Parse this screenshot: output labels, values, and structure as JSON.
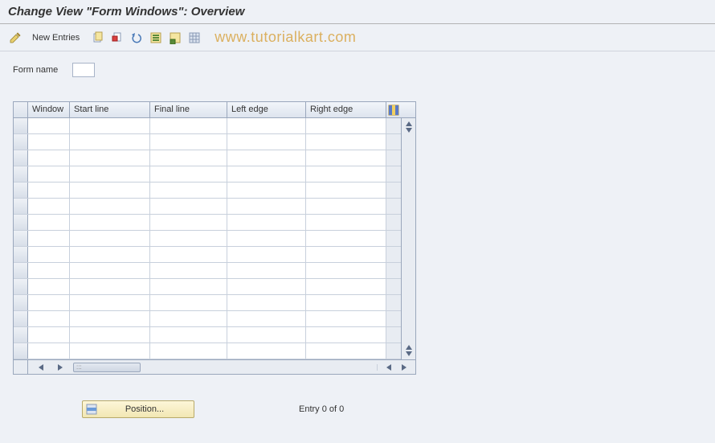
{
  "titlebar": {
    "title": "Change View \"Form Windows\": Overview"
  },
  "toolbar": {
    "new_entries_label": "New Entries",
    "watermark": "www.tutorialkart.com"
  },
  "form": {
    "form_name_label": "Form name",
    "form_name_value": ""
  },
  "table": {
    "columns": {
      "window": "Window",
      "start_line": "Start line",
      "final_line": "Final line",
      "left_edge": "Left edge",
      "right_edge": "Right edge"
    },
    "row_count": 15
  },
  "footer": {
    "position_label": "Position...",
    "entry_status": "Entry 0 of 0"
  }
}
